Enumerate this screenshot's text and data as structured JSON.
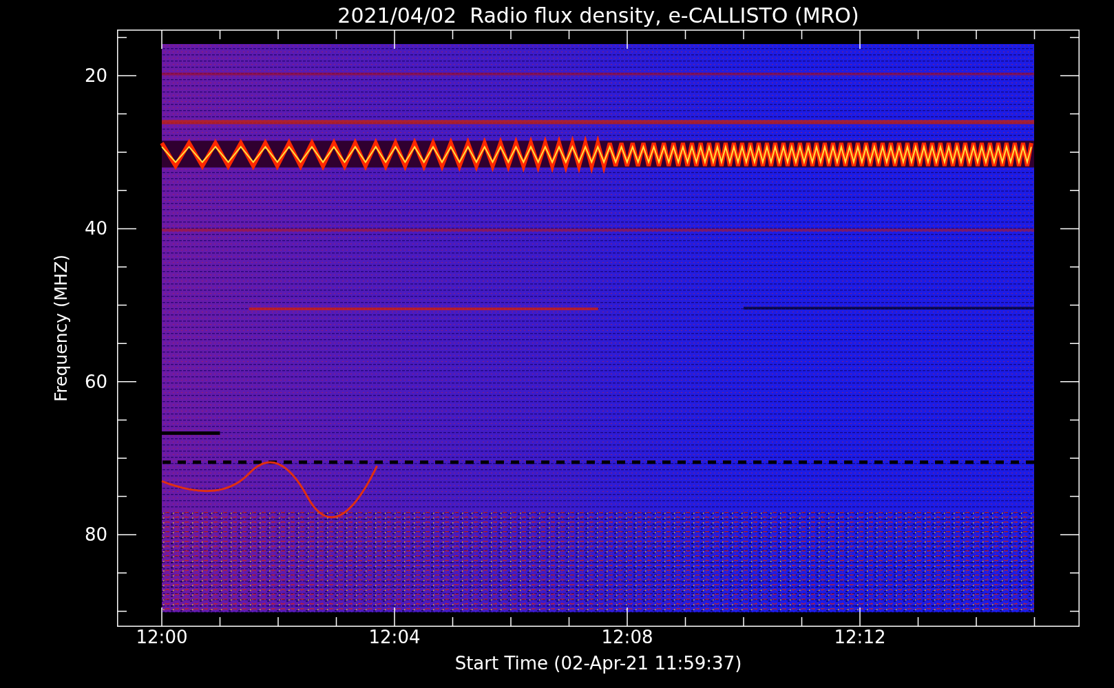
{
  "plot": {
    "title": "2021/04/02  Radio flux density, e-CALLISTO (MRO)",
    "ylabel": "Frequency (MHZ)",
    "xlabel": "Start Time (02-Apr-21 11:59:37)",
    "yticks": [
      "20",
      "40",
      "60",
      "80"
    ],
    "xticks": [
      "12:00",
      "12:04",
      "12:08",
      "12:12"
    ]
  }
}
